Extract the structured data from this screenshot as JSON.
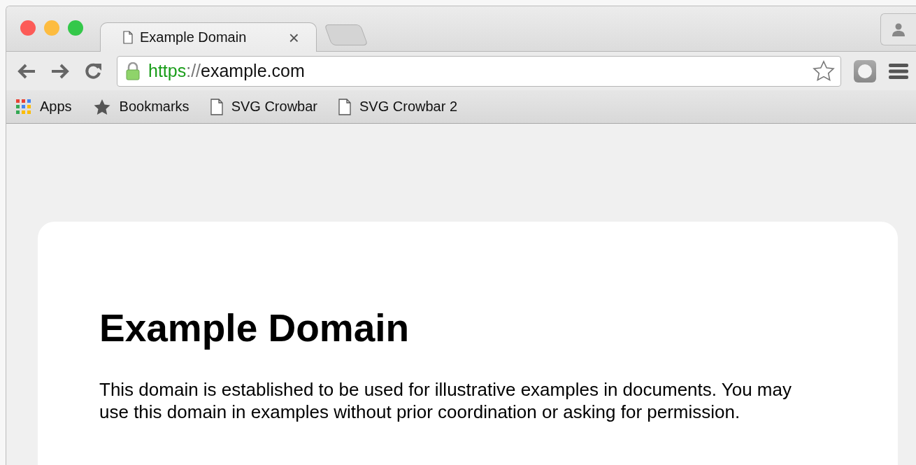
{
  "tabs": [
    {
      "title": "Example Domain",
      "selected": true,
      "close": "×"
    }
  ],
  "address_bar": {
    "secure": true,
    "scheme": "https",
    "separator": "://",
    "host": "example.com",
    "bookmarked": false
  },
  "bookmarks": [
    {
      "label": "Apps",
      "kind": "apps"
    },
    {
      "label": "Bookmarks",
      "kind": "folder"
    },
    {
      "label": "SVG Crowbar",
      "kind": "page"
    },
    {
      "label": "SVG Crowbar 2",
      "kind": "page"
    }
  ],
  "page": {
    "heading": "Example Domain",
    "paragraph": "This domain is established to be used for illustrative examples in documents. You may use this domain in examples without prior coordination or asking for permission."
  }
}
